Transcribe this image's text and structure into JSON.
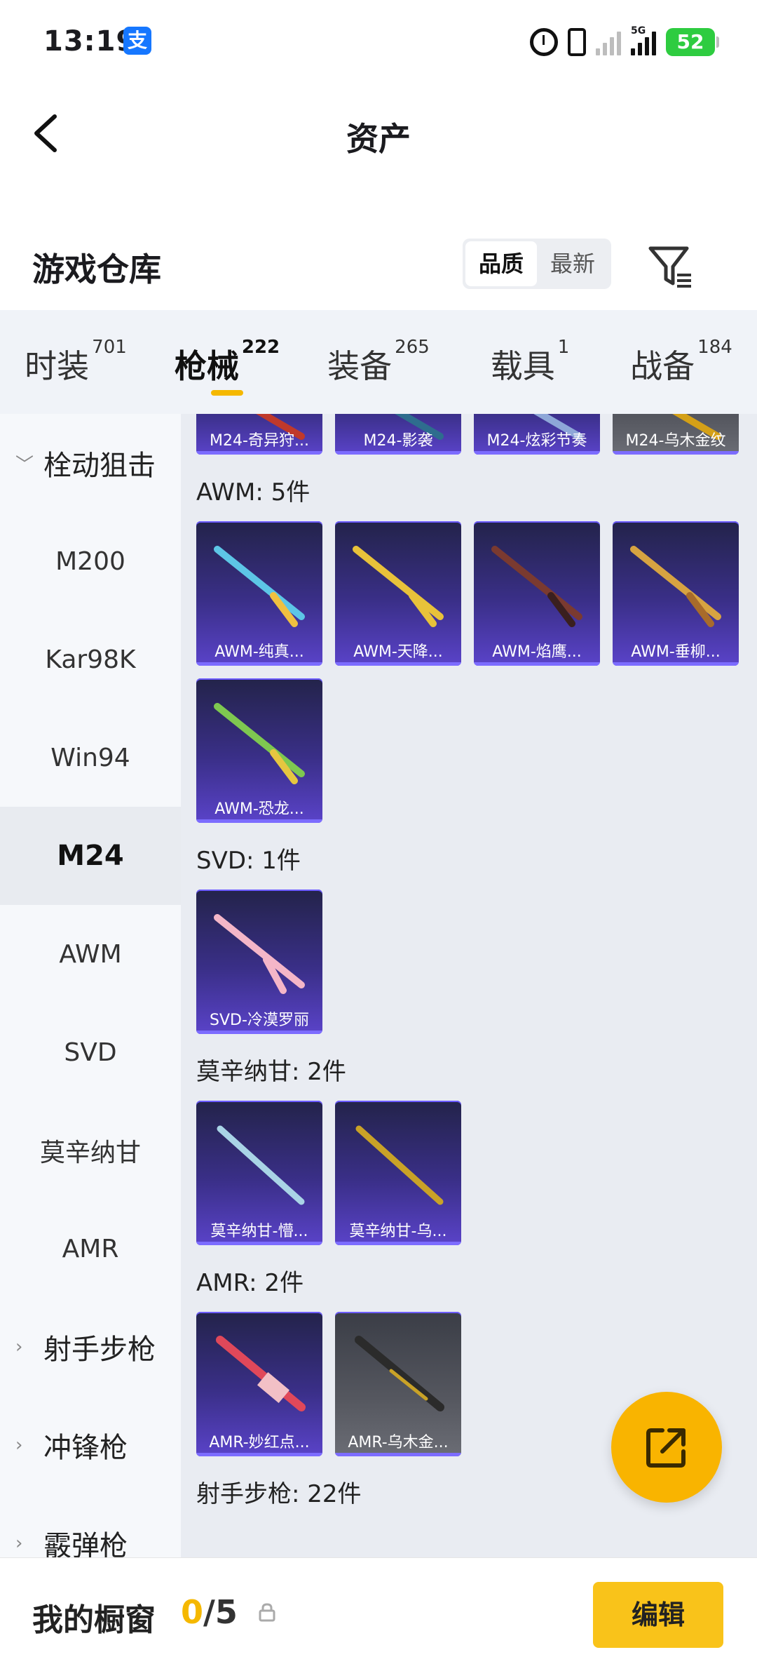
{
  "status": {
    "time": "13:19",
    "network": "5G",
    "battery": "52"
  },
  "header": {
    "title": "资产"
  },
  "warehouse": {
    "title": "游戏仓库",
    "sort_quality": "品质",
    "sort_newest": "最新"
  },
  "tabs": [
    {
      "label": "时装",
      "count": "701"
    },
    {
      "label": "枪械",
      "count": "222"
    },
    {
      "label": "装备",
      "count": "265"
    },
    {
      "label": "载具",
      "count": "1"
    },
    {
      "label": "战备",
      "count": "184"
    }
  ],
  "sidebar": {
    "group1": "栓动狙击",
    "items": [
      "M200",
      "Kar98K",
      "Win94",
      "M24",
      "AWM",
      "SVD",
      "莫辛纳甘",
      "AMR"
    ],
    "group2": "射手步枪",
    "group3": "冲锋枪",
    "group4": "霰弹枪"
  },
  "sections": {
    "m24_items": [
      "M24-奇异狩...",
      "M24-影袭",
      "M24-炫彩节奏",
      "M24-乌木金纹"
    ],
    "awm_title": "AWM: 5件",
    "awm_items": [
      "AWM-纯真...",
      "AWM-天降...",
      "AWM-焰鹰...",
      "AWM-垂柳...",
      "AWM-恐龙..."
    ],
    "svd_title": "SVD: 1件",
    "svd_items": [
      "SVD-冷漠罗丽"
    ],
    "mosin_title": "莫辛纳甘: 2件",
    "mosin_items": [
      "莫辛纳甘-懵...",
      "莫辛纳甘-乌..."
    ],
    "amr_title": "AMR: 2件",
    "amr_items": [
      "AMR-妙红点...",
      "AMR-乌木金..."
    ],
    "marksman_title": "射手步枪: 22件"
  },
  "bottom": {
    "showcase_label": "我的橱窗",
    "count_current": "0",
    "count_total": "/5",
    "edit_label": "编辑"
  },
  "colors": {
    "accent": "#f5b800",
    "card_purple": "#3a2f88",
    "card_gray": "#55575f"
  }
}
